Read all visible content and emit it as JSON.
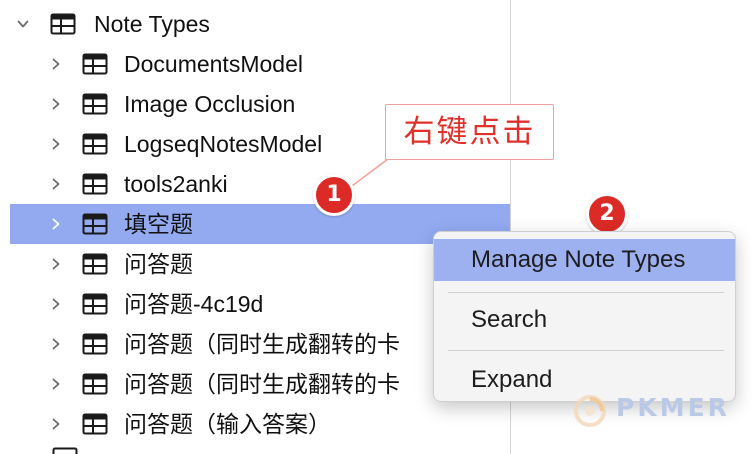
{
  "tree": {
    "root": {
      "label": "Note Types"
    },
    "children": [
      {
        "label": "DocumentsModel"
      },
      {
        "label": "Image Occlusion"
      },
      {
        "label": "LogseqNotesModel"
      },
      {
        "label": "tools2anki"
      },
      {
        "label": "填空题",
        "selected": true
      },
      {
        "label": "问答题"
      },
      {
        "label": "问答题-4c19d"
      },
      {
        "label": "问答题（同时生成翻转的卡"
      },
      {
        "label": "问答题（同时生成翻转的卡"
      },
      {
        "label": "问答题（输入答案）"
      }
    ]
  },
  "annotation": {
    "callout_text": "右键点击",
    "badge1": "1",
    "badge2": "2",
    "color": "#dc2b26"
  },
  "context_menu": {
    "items": [
      {
        "label": "Manage Note Types",
        "highlighted": true
      },
      {
        "label": "Search"
      },
      {
        "label": "Expand"
      }
    ]
  },
  "watermark": {
    "text": "PKMER"
  },
  "colors": {
    "selection": "#93aaf1",
    "menu_highlight": "#9db0ef",
    "accent_red": "#dc2b26"
  }
}
